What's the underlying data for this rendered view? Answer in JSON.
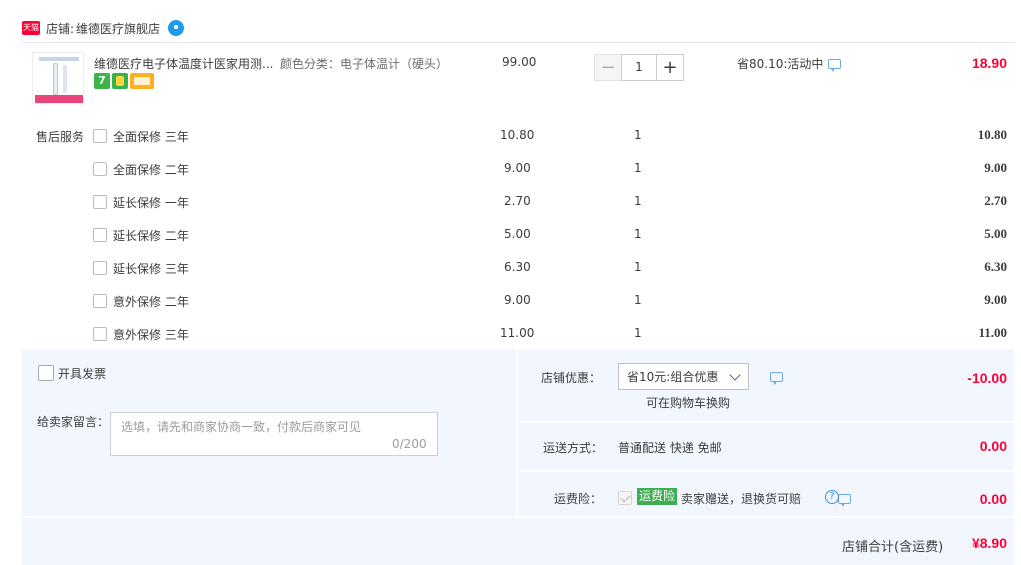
{
  "shop": {
    "badge": "天猫",
    "label": "店铺:",
    "name": "维德医疗旗舰店"
  },
  "product": {
    "title": "维德医疗电子体温度计医家用测...",
    "sku": "颜色分类：电子体温计（硬头）",
    "price": "99.00",
    "quantity": "1",
    "promo": "省80.10:活动中",
    "subtotal": "18.90",
    "icons": [
      "seven-day-return-icon",
      "insurance-icon",
      "card-payment-icon"
    ],
    "badge_text": "7"
  },
  "services": {
    "label": "售后服务",
    "items": [
      {
        "name": "全面保修 三年",
        "price": "10.80",
        "qty": "1",
        "sum": "10.80"
      },
      {
        "name": "全面保修 二年",
        "price": "9.00",
        "qty": "1",
        "sum": "9.00"
      },
      {
        "name": "延长保修 一年",
        "price": "2.70",
        "qty": "1",
        "sum": "2.70"
      },
      {
        "name": "延长保修 二年",
        "price": "5.00",
        "qty": "1",
        "sum": "5.00"
      },
      {
        "name": "延长保修 三年",
        "price": "6.30",
        "qty": "1",
        "sum": "6.30"
      },
      {
        "name": "意外保修 二年",
        "price": "9.00",
        "qty": "1",
        "sum": "9.00"
      },
      {
        "name": "意外保修 三年",
        "price": "11.00",
        "qty": "1",
        "sum": "11.00"
      }
    ]
  },
  "invoice": {
    "label": "开具发票"
  },
  "message": {
    "label": "给卖家留言：",
    "placeholder": "选填，请先和商家协商一致，付款后商家可见",
    "count": "0/200"
  },
  "discount": {
    "label": "店铺优惠：",
    "selected": "省10元:组合优惠",
    "note": "可在购物车换购",
    "amount": "-10.00"
  },
  "shipping": {
    "label": "运送方式：",
    "method": "普通配送 快递 免邮",
    "amount": "0.00"
  },
  "insurance": {
    "label": "运费险：",
    "badge": "运费险",
    "text": "卖家赠送，退换货可赔",
    "help": "?",
    "amount": "0.00"
  },
  "total": {
    "label": "店铺合计(含运费)",
    "amount": "¥8.90"
  },
  "colors": {
    "price_red": "#ff0036",
    "panel_bg": "#f2f7ff",
    "insurance_green": "#3fae52",
    "tmall_red": "#ff0036"
  }
}
